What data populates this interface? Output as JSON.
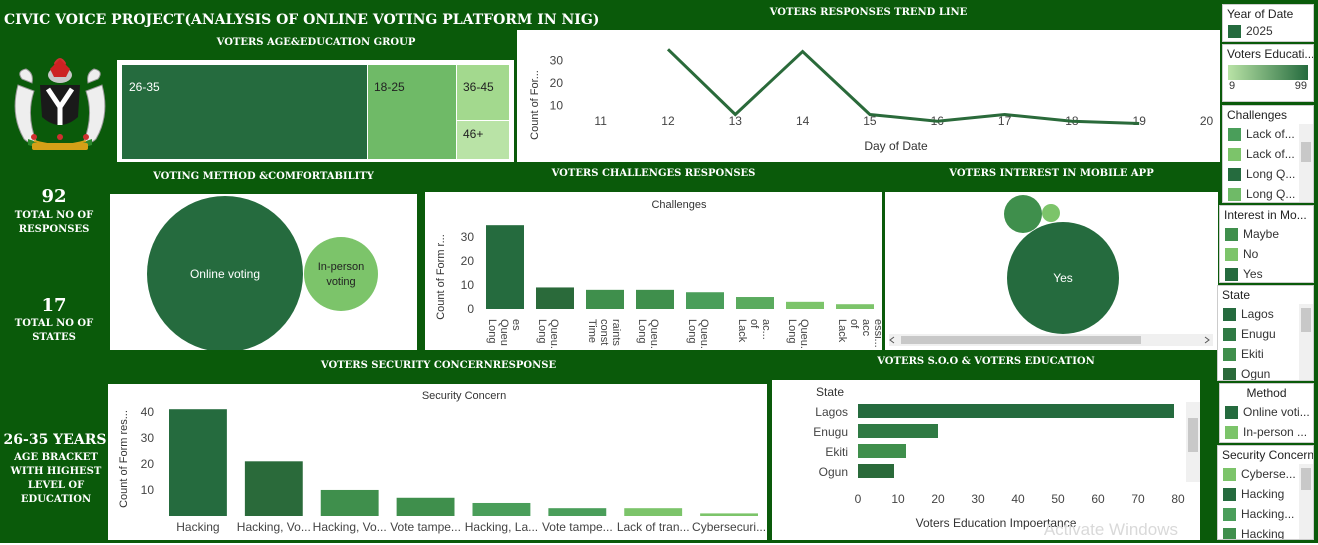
{
  "header": {
    "title": "CIVIC VOICE PROJECT(ANALYSIS OF ONLINE VOTING PLATFORM IN NIG)"
  },
  "kpis": {
    "responses_value": "92",
    "responses_label": "TOTAL NO OF RESPONSES",
    "states_value": "17",
    "states_label": "TOTAL NO OF STATES",
    "age_value": "26-35 YEARS",
    "age_label": "AGE BRACKET WITH HIGHEST LEVEL OF EDUCATION"
  },
  "sections": {
    "age_edu": "VOTERS AGE&EDUCATION GROUP",
    "trend": "VOTERS RESPONSES TREND LINE",
    "method": "VOTING METHOD &COMFORTABILITY",
    "challenges": "VOTERS CHALLENGES RESPONSES",
    "mobile": "VOTERS INTEREST IN MOBILE APP",
    "security": "VOTERS SECURITY CONCERNRESPONSE",
    "soo": "VOTERS S.O.O & VOTERS EDUCATION"
  },
  "watermark": "Activate Windows",
  "colors": {
    "dark": "#1e6b3e",
    "mid": "#4a9e5a",
    "light": "#7cc46a",
    "lighter": "#a3d98e",
    "bg": "#0a5a0a"
  },
  "chart_data": [
    {
      "id": "age_treemap",
      "type": "treemap",
      "categories": [
        "26-35",
        "18-25",
        "36-45",
        "46+"
      ]
    },
    {
      "id": "trend",
      "type": "line",
      "xlabel": "Day of Date",
      "ylabel": "Count of For...",
      "x": [
        12,
        13,
        14,
        15,
        16,
        17,
        18,
        19
      ],
      "y": [
        35,
        6,
        34,
        6,
        3,
        6,
        3,
        2
      ],
      "xticks": [
        "11",
        "12",
        "13",
        "14",
        "15",
        "16",
        "17",
        "18",
        "19",
        "20"
      ],
      "yticks": [
        "10",
        "20",
        "30"
      ],
      "ylim": [
        0,
        40
      ]
    },
    {
      "id": "method",
      "type": "bubble",
      "categories": [
        "Online voting",
        "In-person voting"
      ]
    },
    {
      "id": "challenges",
      "type": "bar",
      "title": "Challenges",
      "ylabel": "Count of Form r...",
      "categories": [
        "Long Queu es",
        "Long Queu...",
        "Time const raints",
        "Long Queu...",
        "Long Queu...",
        "Lack of ac...",
        "Long Queu...",
        "Lack of acc essi..."
      ],
      "values": [
        35,
        9,
        8,
        8,
        7,
        5,
        3,
        2
      ],
      "yticks": [
        "0",
        "10",
        "20",
        "30"
      ],
      "ylim": [
        0,
        38
      ]
    },
    {
      "id": "mobile",
      "type": "bubble",
      "categories": [
        "Yes"
      ]
    },
    {
      "id": "security",
      "type": "bar",
      "title": "Security Concern",
      "ylabel": "Count of Form res...",
      "categories": [
        "Hacking",
        "Hacking, Vo...",
        "Hacking, Vo...",
        "Vote tampe...",
        "Hacking, La...",
        "Vote tampe...",
        "Lack of tran...",
        "Cybersecuri..."
      ],
      "values": [
        41,
        21,
        10,
        7,
        5,
        3,
        3,
        1
      ],
      "yticks": [
        "10",
        "20",
        "30",
        "40"
      ],
      "ylim": [
        0,
        43
      ]
    },
    {
      "id": "soo",
      "type": "bar",
      "orientation": "horizontal",
      "ylabel": "State",
      "xlabel": "Voters Education Impoertance",
      "categories": [
        "Lagos",
        "Enugu",
        "Ekiti",
        "Ogun"
      ],
      "values": [
        79,
        20,
        12,
        9
      ],
      "xticks": [
        "0",
        "10",
        "20",
        "30",
        "40",
        "50",
        "60",
        "70",
        "80"
      ],
      "xlim": [
        0,
        82
      ]
    }
  ],
  "legends": {
    "year": {
      "title": "Year of Date",
      "items": [
        "2025"
      ]
    },
    "education": {
      "title": "Voters Educati...",
      "min": "9",
      "max": "99"
    },
    "challenges": {
      "title": "Challenges",
      "items": [
        "Lack of...",
        "Lack of...",
        "Long Q...",
        "Long Q..."
      ]
    },
    "interest": {
      "title": "Interest in Mo...",
      "items": [
        "Maybe",
        "No",
        "Yes"
      ]
    },
    "state": {
      "title": "State",
      "items": [
        "Lagos",
        "Enugu",
        "Ekiti",
        "Ogun"
      ]
    },
    "method": {
      "title": "Method",
      "items": [
        "Online voti...",
        "In-person ..."
      ]
    },
    "security": {
      "title": "Security Concern",
      "items": [
        "Cyberse...",
        "Hacking",
        "Hacking...",
        "Hacking"
      ]
    }
  }
}
